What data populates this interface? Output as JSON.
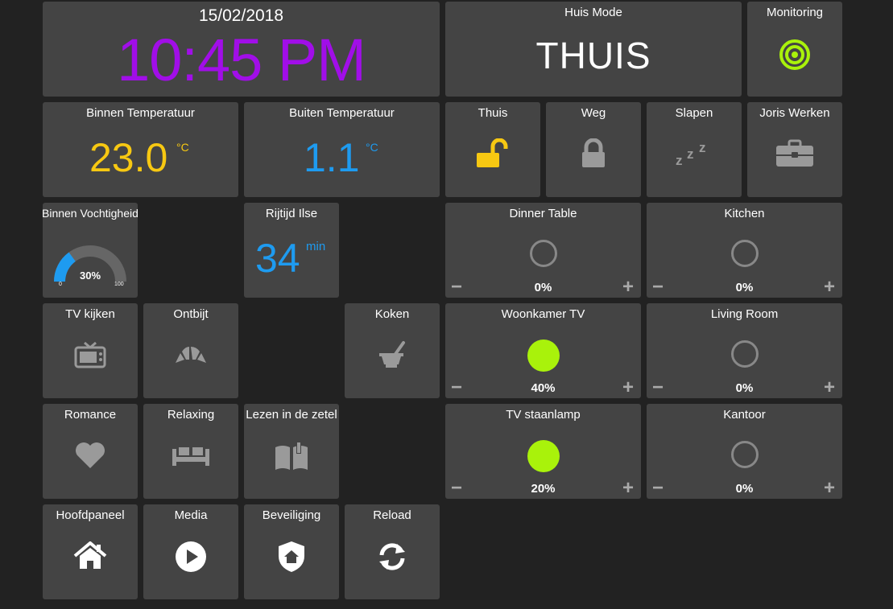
{
  "clock": {
    "date": "15/02/2018",
    "time": "10:45 PM"
  },
  "house_mode": {
    "title": "Huis Mode",
    "value": "THUIS"
  },
  "monitoring": {
    "title": "Monitoring",
    "icon": "target-icon",
    "color": "#a9f20b"
  },
  "indoor_temp": {
    "title": "Binnen Temperatuur",
    "value": "23.0",
    "unit": "°C",
    "color": "#f7c812"
  },
  "outdoor_temp": {
    "title": "Buiten Temperatuur",
    "value": "1.1",
    "unit": "°C",
    "color": "#1e9bf0"
  },
  "modes": [
    {
      "title": "Thuis",
      "icon": "unlocked-padlock-icon",
      "color": "#f7c812"
    },
    {
      "title": "Weg",
      "icon": "locked-padlock-icon",
      "color": "#9a9a9a"
    },
    {
      "title": "Slapen",
      "icon": "zzz-sleep-icon",
      "color": "#9a9a9a"
    },
    {
      "title": "Joris Werken",
      "icon": "briefcase-icon",
      "color": "#9a9a9a"
    }
  ],
  "humidity": {
    "title": "Binnen Vochtigheid",
    "value": "30%",
    "level": 0.3,
    "min": "0",
    "max": "100",
    "color": "#1e9bf0"
  },
  "commute": {
    "title": "Rijtijd Ilse",
    "value": "34",
    "unit": "min",
    "color": "#1e9bf0"
  },
  "dimmers": [
    {
      "title": "Dinner Table",
      "percent": "0%",
      "on": false
    },
    {
      "title": "Kitchen",
      "percent": "0%",
      "on": false
    },
    {
      "title": "Woonkamer TV",
      "percent": "40%",
      "on": true
    },
    {
      "title": "Living Room",
      "percent": "0%",
      "on": false
    },
    {
      "title": "TV staanlamp",
      "percent": "20%",
      "on": true
    },
    {
      "title": "Kantoor",
      "percent": "0%",
      "on": false
    }
  ],
  "dimmer_controls": {
    "minus": "−",
    "plus": "+"
  },
  "scenes": [
    {
      "title": "TV kijken",
      "icon": "tv-icon"
    },
    {
      "title": "Ontbijt",
      "icon": "croissant-icon"
    },
    {
      "title": "Koken",
      "icon": "mortar-pestle-icon"
    },
    {
      "title": "Romance",
      "icon": "heart-icon"
    },
    {
      "title": "Relaxing",
      "icon": "sofa-icon"
    },
    {
      "title": "Lezen in de zetel",
      "icon": "open-book-icon"
    }
  ],
  "navigation": [
    {
      "title": "Hoofdpaneel",
      "icon": "home-icon"
    },
    {
      "title": "Media",
      "icon": "play-circle-icon"
    },
    {
      "title": "Beveiliging",
      "icon": "shield-home-icon"
    },
    {
      "title": "Reload",
      "icon": "refresh-icon"
    }
  ]
}
